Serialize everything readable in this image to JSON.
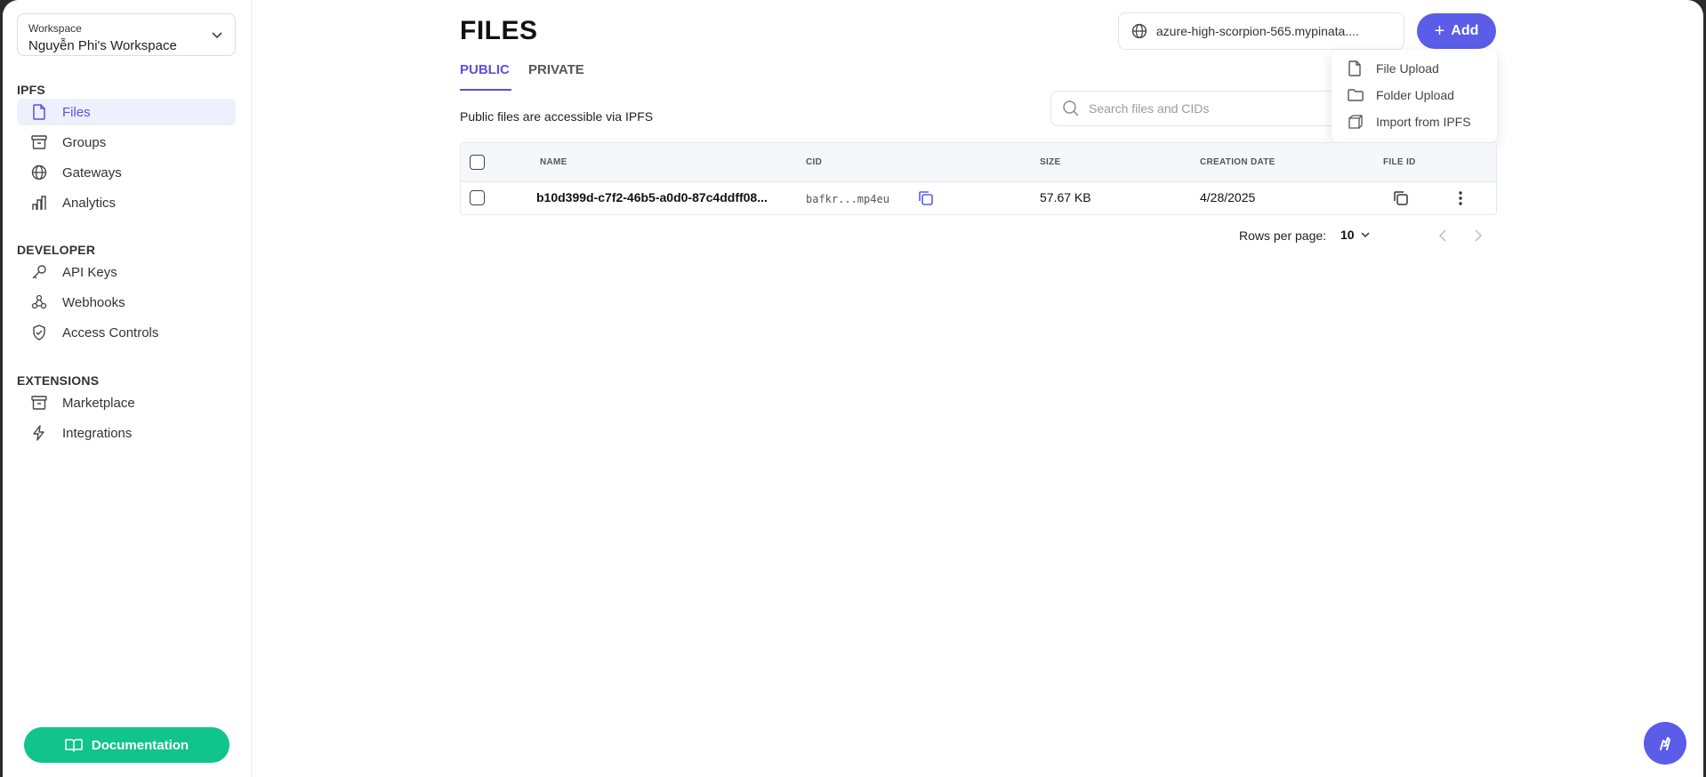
{
  "workspace": {
    "label": "Workspace",
    "name": "Nguyễn Phi's Workspace"
  },
  "sidebar": {
    "sections": [
      {
        "title": "IPFS",
        "items": [
          {
            "label": "Files",
            "icon": "file-icon",
            "active": true
          },
          {
            "label": "Groups",
            "icon": "archive-icon",
            "active": false
          },
          {
            "label": "Gateways",
            "icon": "globe-icon",
            "active": false
          },
          {
            "label": "Analytics",
            "icon": "bar-chart-icon",
            "active": false
          }
        ]
      },
      {
        "title": "DEVELOPER",
        "items": [
          {
            "label": "API Keys",
            "icon": "key-icon",
            "active": false
          },
          {
            "label": "Webhooks",
            "icon": "webhook-icon",
            "active": false
          },
          {
            "label": "Access Controls",
            "icon": "shield-icon",
            "active": false
          }
        ]
      },
      {
        "title": "EXTENSIONS",
        "items": [
          {
            "label": "Marketplace",
            "icon": "archive-icon",
            "active": false
          },
          {
            "label": "Integrations",
            "icon": "bolt-icon",
            "active": false
          }
        ]
      }
    ],
    "documentation_label": "Documentation"
  },
  "header": {
    "title": "FILES",
    "tabs": [
      {
        "label": "PUBLIC",
        "active": true
      },
      {
        "label": "PRIVATE",
        "active": false
      }
    ],
    "gateway": "azure-high-scorpion-565.mypinata....",
    "add_label": "Add",
    "description": "Public files are accessible via IPFS"
  },
  "add_menu": {
    "items": [
      {
        "label": "File Upload",
        "icon": "file-icon"
      },
      {
        "label": "Folder Upload",
        "icon": "folder-icon"
      },
      {
        "label": "Import from IPFS",
        "icon": "box-icon"
      }
    ]
  },
  "search": {
    "placeholder": "Search files and CIDs"
  },
  "table": {
    "columns": [
      "NAME",
      "CID",
      "SIZE",
      "CREATION DATE",
      "FILE ID"
    ],
    "rows": [
      {
        "name": "b10d399d-c7f2-46b5-a0d0-87c4ddff08...",
        "cid": "bafkr...mp4eu",
        "size": "57.67 KB",
        "date": "4/28/2025"
      }
    ]
  },
  "pagination": {
    "rows_label": "Rows per page:",
    "rows_value": "10"
  },
  "colors": {
    "accent": "#5b5ce8",
    "active_text": "#5b4fe0",
    "documentation_bg": "#10c48b"
  }
}
